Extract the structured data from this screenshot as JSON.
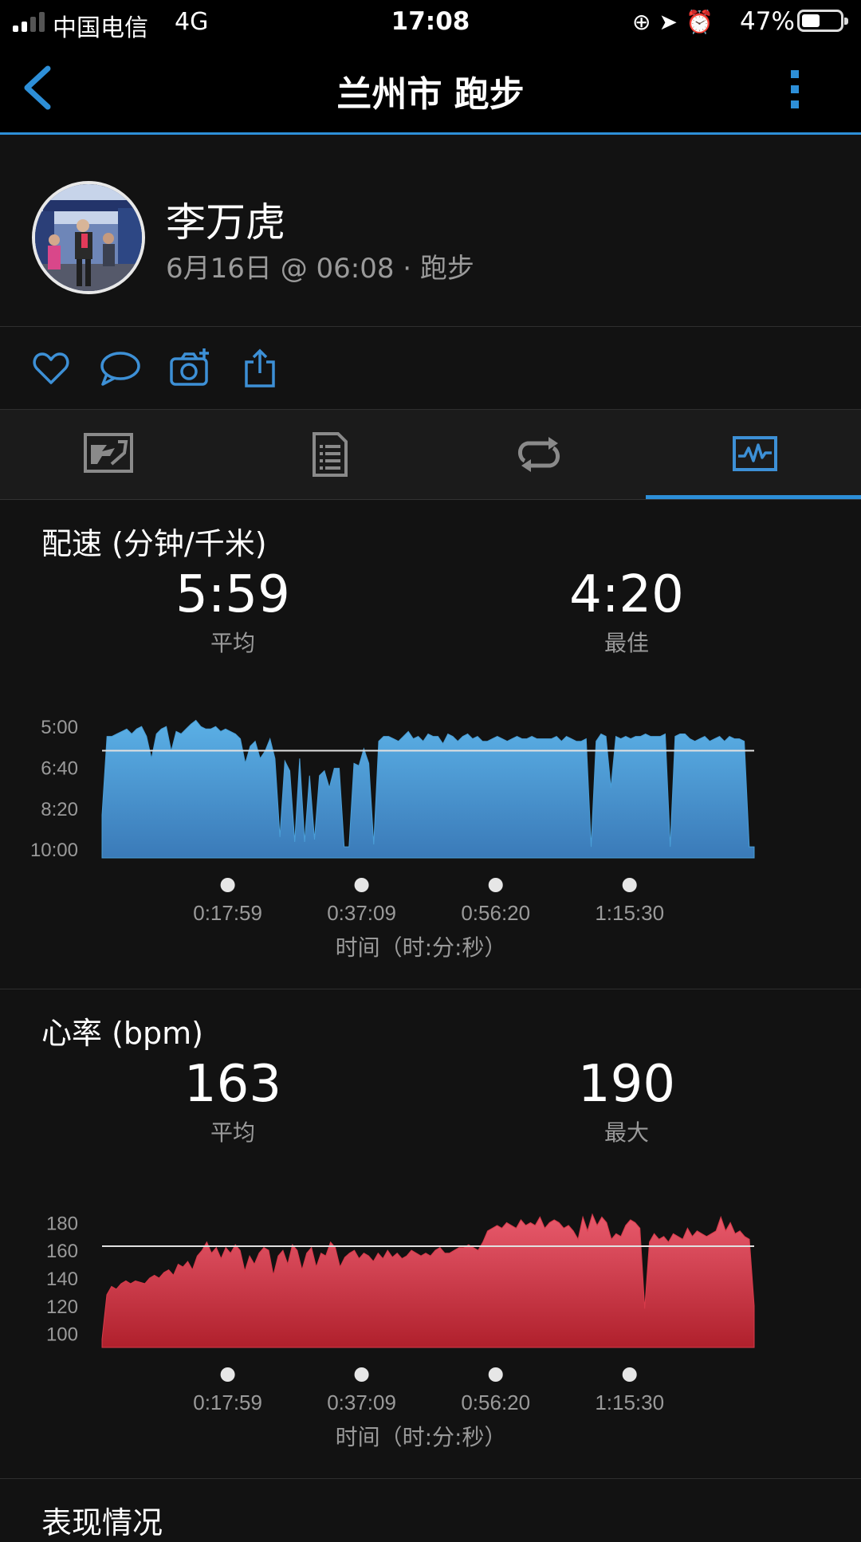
{
  "status_bar": {
    "carrier": "中国电信",
    "network": "4G",
    "time": "17:08",
    "battery": "47%",
    "battery_level": 0.47
  },
  "nav": {
    "title": "兰州市 跑步"
  },
  "profile": {
    "name": "李万虎",
    "meta": "6月16日 @ 06:08 · 跑步"
  },
  "actions": [
    {
      "icon": "heart-icon"
    },
    {
      "icon": "comment-icon"
    },
    {
      "icon": "camera-add-icon"
    },
    {
      "icon": "share-icon"
    }
  ],
  "tabs": [
    {
      "icon": "map-icon",
      "active": false
    },
    {
      "icon": "details-icon",
      "active": false
    },
    {
      "icon": "laps-icon",
      "active": false
    },
    {
      "icon": "charts-icon",
      "active": true
    }
  ],
  "pace": {
    "title": "配速 (分钟/千米)",
    "avg_value": "5:59",
    "avg_label": "平均",
    "best_value": "4:20",
    "best_label": "最佳",
    "xlabel": "时间（时:分:秒）",
    "color": "#4a9fd8"
  },
  "heart": {
    "title": "心率 (bpm)",
    "avg_value": "163",
    "avg_label": "平均",
    "max_value": "190",
    "max_label": "最大",
    "xlabel": "时间（时:分:秒）",
    "color": "#d83a4a"
  },
  "performance": {
    "title": "表现情况"
  },
  "chart_data": [
    {
      "type": "area",
      "series": [
        {
          "values": [
            8.6,
            5.4,
            5.4,
            5.3,
            5.2,
            5.1,
            5.3,
            5.1,
            5.0,
            5.4,
            6.3,
            5.3,
            5.1,
            5.0,
            6.0,
            5.2,
            5.3,
            5.1,
            4.9,
            4.75,
            5.0,
            5.1,
            5.1,
            5.0,
            5.2,
            5.1,
            5.2,
            5.3,
            5.5,
            6.5,
            5.8,
            5.6,
            6.3,
            6.0,
            5.5,
            6.3,
            9.5,
            6.4,
            6.8,
            9.7,
            6.3,
            9.7,
            7.0,
            9.6,
            7.0,
            6.8,
            7.5,
            6.7,
            6.7,
            9.9,
            9.9,
            6.5,
            6.6,
            5.9,
            6.5,
            9.8,
            5.6,
            5.4,
            5.4,
            5.5,
            5.6,
            5.4,
            5.2,
            5.5,
            5.4,
            5.6,
            5.3,
            5.4,
            5.4,
            5.7,
            5.3,
            5.4,
            5.6,
            5.4,
            5.3,
            5.5,
            5.4,
            5.6,
            5.6,
            5.5,
            5.4,
            5.5,
            5.6,
            5.5,
            5.4,
            5.5,
            5.5,
            5.4,
            5.5,
            5.5,
            5.5,
            5.5,
            5.4,
            5.6,
            5.4,
            5.5,
            5.6,
            5.6,
            5.5,
            9.9,
            5.6,
            5.3,
            5.4,
            7.5,
            5.4,
            5.5,
            5.4,
            5.5,
            5.4,
            5.4,
            5.3,
            5.4,
            5.4,
            5.4,
            5.3,
            9.9,
            5.4,
            5.3,
            5.3,
            5.5,
            5.6,
            5.5,
            5.4,
            5.6,
            5.5,
            5.4,
            5.6,
            5.4,
            5.5,
            5.5,
            5.6,
            9.9,
            9.9
          ]
        }
      ],
      "x_tick_labels": [
        "0:17:59",
        "0:37:09",
        "0:56:20",
        "1:15:30"
      ],
      "x_ticks": [
        1079,
        2229,
        3380,
        4530
      ],
      "x_range": [
        0,
        5600
      ],
      "y_tick_labels": [
        "5:00",
        "6:40",
        "8:20",
        "10:00"
      ],
      "y_ticks": [
        5.0,
        6.667,
        8.333,
        10.0
      ],
      "ylim": [
        4.7,
        10.35
      ],
      "avg_line": 5.983,
      "y_inverted": true,
      "xlabel": "时间（时:分:秒）",
      "ylabel": "配速 (分钟/千米)"
    },
    {
      "type": "area",
      "series": [
        {
          "values": [
            96,
            128,
            134,
            132,
            136,
            138,
            136,
            138,
            137,
            136,
            140,
            142,
            140,
            144,
            146,
            142,
            150,
            148,
            152,
            146,
            156,
            160,
            166,
            158,
            162,
            154,
            162,
            158,
            164,
            160,
            145,
            156,
            150,
            158,
            162,
            160,
            142,
            156,
            160,
            150,
            164,
            160,
            146,
            158,
            162,
            148,
            158,
            156,
            166,
            162,
            148,
            155,
            158,
            160,
            154,
            158,
            156,
            152,
            158,
            154,
            160,
            155,
            158,
            154,
            156,
            160,
            158,
            156,
            158,
            156,
            160,
            162,
            158,
            158,
            160,
            162,
            162,
            164,
            162,
            160,
            166,
            174,
            176,
            178,
            176,
            180,
            178,
            176,
            182,
            178,
            180,
            178,
            184,
            176,
            180,
            182,
            180,
            176,
            178,
            174,
            168,
            184,
            174,
            186,
            178,
            184,
            180,
            168,
            172,
            170,
            178,
            182,
            180,
            176,
            118,
            166,
            172,
            168,
            170,
            166,
            172,
            170,
            168,
            176,
            170,
            174,
            172,
            170,
            172,
            174,
            184,
            174,
            180,
            172,
            174,
            170,
            168,
            120
          ]
        }
      ],
      "x_tick_labels": [
        "0:17:59",
        "0:37:09",
        "0:56:20",
        "1:15:30"
      ],
      "x_ticks": [
        1079,
        2229,
        3380,
        4530
      ],
      "x_range": [
        0,
        5600
      ],
      "y_tick_labels": [
        "180",
        "160",
        "140",
        "120",
        "100"
      ],
      "y_ticks": [
        180,
        160,
        140,
        120,
        100
      ],
      "ylim": [
        90,
        190
      ],
      "avg_line": 163,
      "xlabel": "时间（时:分:秒）",
      "ylabel": "心率 (bpm)"
    }
  ]
}
